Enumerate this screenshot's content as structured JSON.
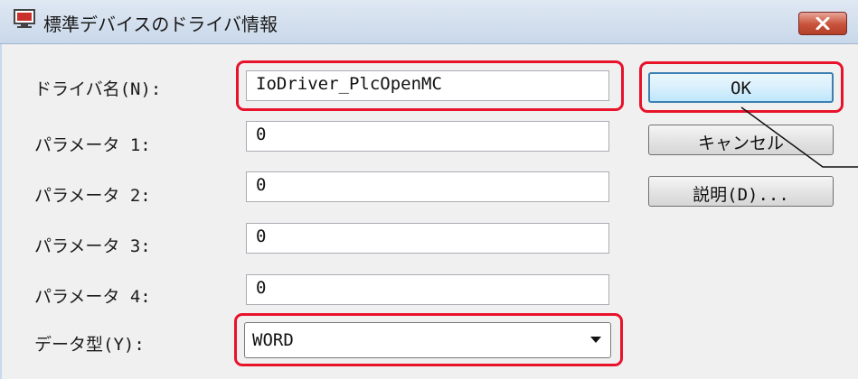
{
  "window": {
    "title": "標準デバイスのドライバ情報"
  },
  "labels": {
    "driver_name": "ドライバ名(N):",
    "param1": "パラメータ 1:",
    "param2": "パラメータ 2:",
    "param3": "パラメータ 3:",
    "param4": "パラメータ 4:",
    "data_type": "データ型(Y):"
  },
  "fields": {
    "driver_name": "IoDriver_PlcOpenMC",
    "param1": "0",
    "param2": "0",
    "param3": "0",
    "param4": "0"
  },
  "data_type": {
    "selected": "WORD"
  },
  "buttons": {
    "ok": "OK",
    "cancel": "キャンセル",
    "help": "説明(D)..."
  },
  "colors": {
    "highlight": "#e8132b",
    "close_button": "#c8523a",
    "ok_border": "#3c7fb1"
  }
}
